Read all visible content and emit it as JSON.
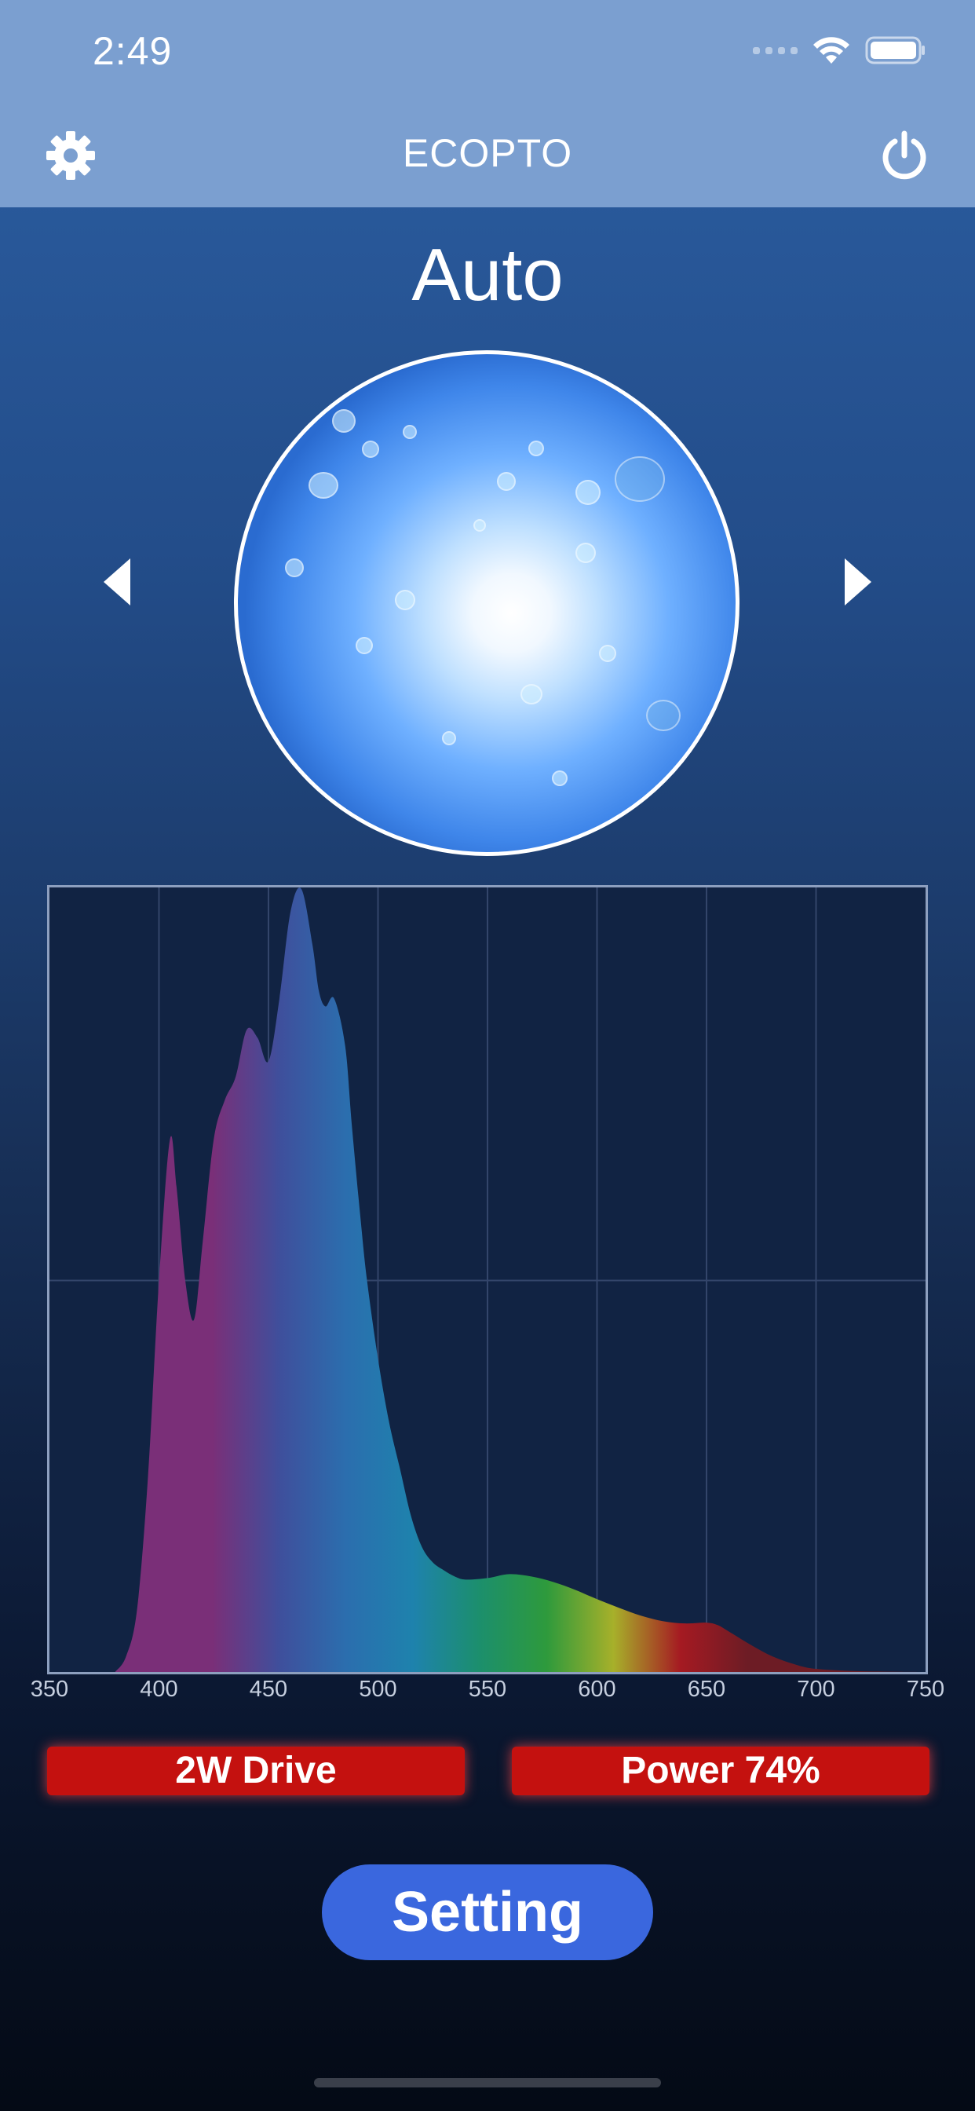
{
  "status_bar": {
    "time": "2:49",
    "icons": [
      "cellular-signal-icon",
      "wifi-icon",
      "battery-icon"
    ]
  },
  "navbar": {
    "title": "ECOPTO",
    "left_icon": "gear-icon",
    "right_icon": "power-icon"
  },
  "mode": {
    "label": "Auto",
    "prev_icon": "chevron-left-icon",
    "next_icon": "chevron-right-icon"
  },
  "chart_data": {
    "type": "area",
    "title": "",
    "xlabel": "",
    "ylabel": "",
    "xlim": [
      350,
      750
    ],
    "ylim": [
      0,
      1
    ],
    "grid": true,
    "x_ticks": [
      "350",
      "400",
      "450",
      "500",
      "550",
      "600",
      "650",
      "700",
      "750"
    ],
    "x": [
      380,
      385,
      390,
      395,
      400,
      405,
      408,
      412,
      416,
      420,
      425,
      430,
      435,
      440,
      445,
      450,
      455,
      460,
      465,
      470,
      473,
      476,
      480,
      485,
      488,
      492,
      495,
      500,
      505,
      510,
      515,
      520,
      525,
      530,
      535,
      540,
      550,
      560,
      570,
      580,
      590,
      600,
      610,
      620,
      630,
      640,
      650,
      655,
      660,
      670,
      680,
      690,
      700,
      720,
      750
    ],
    "y": [
      0,
      0.02,
      0.08,
      0.25,
      0.5,
      0.68,
      0.62,
      0.5,
      0.45,
      0.55,
      0.68,
      0.73,
      0.76,
      0.82,
      0.81,
      0.78,
      0.86,
      0.97,
      1.0,
      0.93,
      0.87,
      0.85,
      0.86,
      0.8,
      0.7,
      0.58,
      0.5,
      0.4,
      0.32,
      0.26,
      0.2,
      0.16,
      0.14,
      0.13,
      0.122,
      0.118,
      0.12,
      0.125,
      0.122,
      0.115,
      0.105,
      0.093,
      0.082,
      0.072,
      0.065,
      0.062,
      0.063,
      0.06,
      0.052,
      0.035,
      0.02,
      0.01,
      0.004,
      0.001,
      0
    ],
    "gradient_colors": [
      "#7a2f78",
      "#3f4f9c",
      "#2b6eae",
      "#1e82ad",
      "#1c8f6c",
      "#2e9a3c",
      "#a7b02a",
      "#a51a22",
      "#6d1c25"
    ]
  },
  "badges": {
    "drive": "2W Drive",
    "power": "Power 74%",
    "color": "#c4110f"
  },
  "setting_button": {
    "label": "Setting",
    "color": "#3a67de"
  }
}
